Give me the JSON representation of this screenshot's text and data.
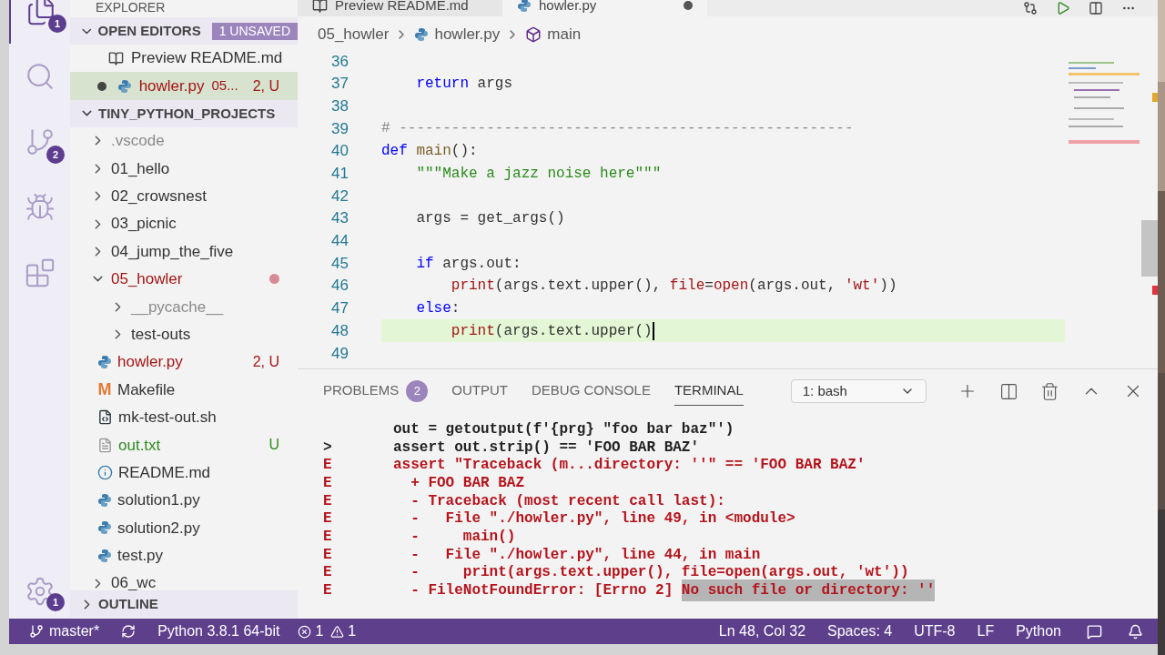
{
  "activity_bar": {
    "items": [
      {
        "kind": "explorer",
        "selected": true,
        "badge": "1"
      },
      {
        "kind": "search",
        "selected": false
      },
      {
        "kind": "source-control",
        "selected": false,
        "badge": "2"
      },
      {
        "kind": "debug",
        "selected": false
      },
      {
        "kind": "extensions",
        "selected": false
      }
    ],
    "settings_badge": "1"
  },
  "sidebar": {
    "title": "EXPLORER",
    "open_editors": {
      "label": "OPEN EDITORS",
      "expanded": true,
      "badge": "1 UNSAVED",
      "items": [
        {
          "name": "Preview README.md",
          "kind": "preview",
          "dirty": false,
          "selected": false,
          "color": "#333333"
        },
        {
          "name": "howler.py",
          "detail": "05...",
          "status": "2, U",
          "kind": "python",
          "dirty": true,
          "selected": true,
          "color": "#a31515"
        }
      ]
    },
    "project": {
      "label": "TINY_PYTHON_PROJECTS",
      "expanded": true,
      "children": [
        {
          "name": ".vscode",
          "kind": "folder",
          "expanded": false,
          "color": "#8a8a8a"
        },
        {
          "name": "01_hello",
          "kind": "folder",
          "expanded": false,
          "color": "#333333"
        },
        {
          "name": "02_crowsnest",
          "kind": "folder",
          "expanded": false,
          "color": "#333333"
        },
        {
          "name": "03_picnic",
          "kind": "folder",
          "expanded": false,
          "color": "#333333"
        },
        {
          "name": "04_jump_the_five",
          "kind": "folder",
          "expanded": false,
          "color": "#333333"
        },
        {
          "name": "05_howler",
          "kind": "folder",
          "expanded": true,
          "color": "#a31515",
          "dot": true,
          "children": [
            {
              "name": "__pycache__",
              "kind": "folder",
              "expanded": false,
              "color": "#8a8a8a"
            },
            {
              "name": "test-outs",
              "kind": "folder",
              "expanded": false,
              "color": "#333333"
            },
            {
              "name": "howler.py",
              "kind": "python",
              "color": "#a31515",
              "status": "2, U"
            },
            {
              "name": "Makefile",
              "kind": "makefile",
              "icon_text": "M",
              "color": "#333333"
            },
            {
              "name": "mk-test-out.sh",
              "kind": "shell",
              "color": "#333333"
            },
            {
              "name": "out.txt",
              "kind": "text",
              "color": "#2f8a1e",
              "status": "U"
            },
            {
              "name": "README.md",
              "kind": "info",
              "color": "#333333"
            },
            {
              "name": "solution1.py",
              "kind": "python",
              "color": "#333333"
            },
            {
              "name": "solution2.py",
              "kind": "python",
              "color": "#333333"
            },
            {
              "name": "test.py",
              "kind": "python",
              "color": "#333333"
            }
          ]
        },
        {
          "name": "06_wc",
          "kind": "folder",
          "expanded": false,
          "color": "#333333"
        }
      ]
    },
    "outline": {
      "label": "OUTLINE",
      "expanded": false
    }
  },
  "editor": {
    "tabs": [
      {
        "label": "Preview README.md",
        "kind": "preview",
        "selected": false,
        "dirty": false
      },
      {
        "label": "howler.py",
        "kind": "python",
        "selected": true,
        "dirty": true
      }
    ],
    "breadcrumb": [
      {
        "label": "05_howler",
        "kind": "folder"
      },
      {
        "label": "howler.py",
        "kind": "python"
      },
      {
        "label": "main",
        "kind": "symbol"
      }
    ],
    "lines": [
      {
        "number": "36",
        "current": false
      },
      {
        "number": "37",
        "current": false,
        "tokens": [
          {
            "t": "    return",
            "kind": "keyword"
          },
          {
            "t": " args",
            "kind": "plain"
          }
        ]
      },
      {
        "number": "38",
        "current": false
      },
      {
        "number": "39",
        "current": false,
        "tokens": [
          {
            "t": "# ----------------------------------------------------",
            "kind": "comment"
          }
        ]
      },
      {
        "number": "40",
        "current": false,
        "tokens": [
          {
            "t": "def ",
            "kind": "keyword"
          },
          {
            "t": "main",
            "kind": "function"
          },
          {
            "t": "():",
            "kind": "plain"
          }
        ]
      },
      {
        "number": "41",
        "current": false,
        "tokens": [
          {
            "t": "    \"\"\"Make a jazz noise here\"\"\"",
            "kind": "docstring"
          }
        ]
      },
      {
        "number": "42",
        "current": false
      },
      {
        "number": "43",
        "current": false,
        "tokens": [
          {
            "t": "    args = get_args()",
            "kind": "plain"
          }
        ]
      },
      {
        "number": "44",
        "current": false
      },
      {
        "number": "45",
        "current": false,
        "tokens": [
          {
            "t": "    if",
            "kind": "keyword"
          },
          {
            "t": " args.out:",
            "kind": "plain"
          }
        ]
      },
      {
        "number": "46",
        "current": false,
        "tokens": [
          {
            "t": "        print",
            "kind": "builtin"
          },
          {
            "t": "(args.text.upper(), ",
            "kind": "plain"
          },
          {
            "t": "file",
            "kind": "param"
          },
          {
            "t": "=",
            "kind": "plain"
          },
          {
            "t": "open",
            "kind": "builtin"
          },
          {
            "t": "(args.out, ",
            "kind": "plain"
          },
          {
            "t": "'wt'",
            "kind": "string"
          },
          {
            "t": "))",
            "kind": "plain"
          }
        ]
      },
      {
        "number": "47",
        "current": false,
        "tokens": [
          {
            "t": "    else",
            "kind": "keyword"
          },
          {
            "t": ":",
            "kind": "plain"
          }
        ]
      },
      {
        "number": "48",
        "current": true,
        "tokens": [
          {
            "t": "        print",
            "kind": "builtin"
          },
          {
            "t": "(args.text.upper()",
            "kind": "plain"
          }
        ]
      },
      {
        "number": "49",
        "current": false
      }
    ]
  },
  "panel": {
    "tabs": [
      {
        "label": "PROBLEMS",
        "badge": "2",
        "selected": false
      },
      {
        "label": "OUTPUT",
        "selected": false
      },
      {
        "label": "DEBUG CONSOLE",
        "selected": false
      },
      {
        "label": "TERMINAL",
        "selected": true
      }
    ],
    "terminal_select": "1: bash",
    "lines": [
      {
        "text": "out = getoutput(f'{prg} \"foo bar baz\"')",
        "kind": "normal"
      },
      {
        "prefix": ">",
        "text": "assert out.strip() == 'FOO BAR BAZ'",
        "kind": "normal"
      },
      {
        "prefix": "E",
        "text": "assert \"Traceback (m...directory: ''\" == 'FOO BAR BAZ'",
        "kind": "error"
      },
      {
        "prefix": "E",
        "text": "  + FOO BAR BAZ",
        "kind": "error"
      },
      {
        "prefix": "E",
        "text": "  - Traceback (most recent call last):",
        "kind": "error"
      },
      {
        "prefix": "E",
        "text": "  -   File \"./howler.py\", line 49, in <module>",
        "kind": "error"
      },
      {
        "prefix": "E",
        "text": "  -     main()",
        "kind": "error"
      },
      {
        "prefix": "E",
        "text": "  -   File \"./howler.py\", line 44, in main",
        "kind": "error"
      },
      {
        "prefix": "E",
        "text": "  -     print(args.text.upper(), file=open(args.out, 'wt'))",
        "kind": "error"
      },
      {
        "prefix": "E",
        "text": "  - FileNotFoundError: [Errno 2] ",
        "highlight": "No such file or directory: ''",
        "kind": "error"
      }
    ]
  },
  "status_bar": {
    "branch": "master*",
    "interpreter": "Python 3.8.1 64-bit",
    "errors": "1",
    "warnings": "1",
    "right": [
      "Ln 48, Col 32",
      "Spaces: 4",
      "UTF-8",
      "LF",
      "Python"
    ]
  }
}
